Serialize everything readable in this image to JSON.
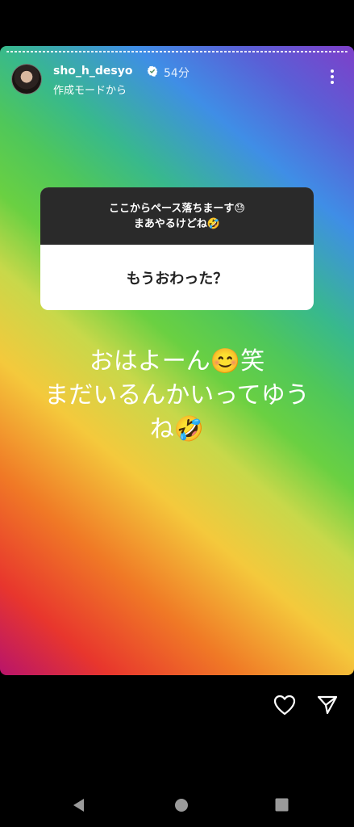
{
  "header": {
    "username": "sho_h_desyo",
    "time": "54分",
    "subtitle": "作成モードから"
  },
  "question_sticker": {
    "line1": "ここからペース落ちまーす😓",
    "line2": "まあやるけどね🤣",
    "answer": "もうおわった？"
  },
  "story_text": {
    "line1": "おはよーん😊笑",
    "line2": "まだいるんかいってゆう",
    "line3": "ね🤣"
  },
  "icons": {
    "like": "heart-icon",
    "share": "send-icon",
    "more": "more-vertical-icon",
    "verified": "verified-badge-icon"
  },
  "colors": {
    "background": "#000000",
    "text": "#ffffff",
    "sticker_dark": "#2a2a2a"
  }
}
